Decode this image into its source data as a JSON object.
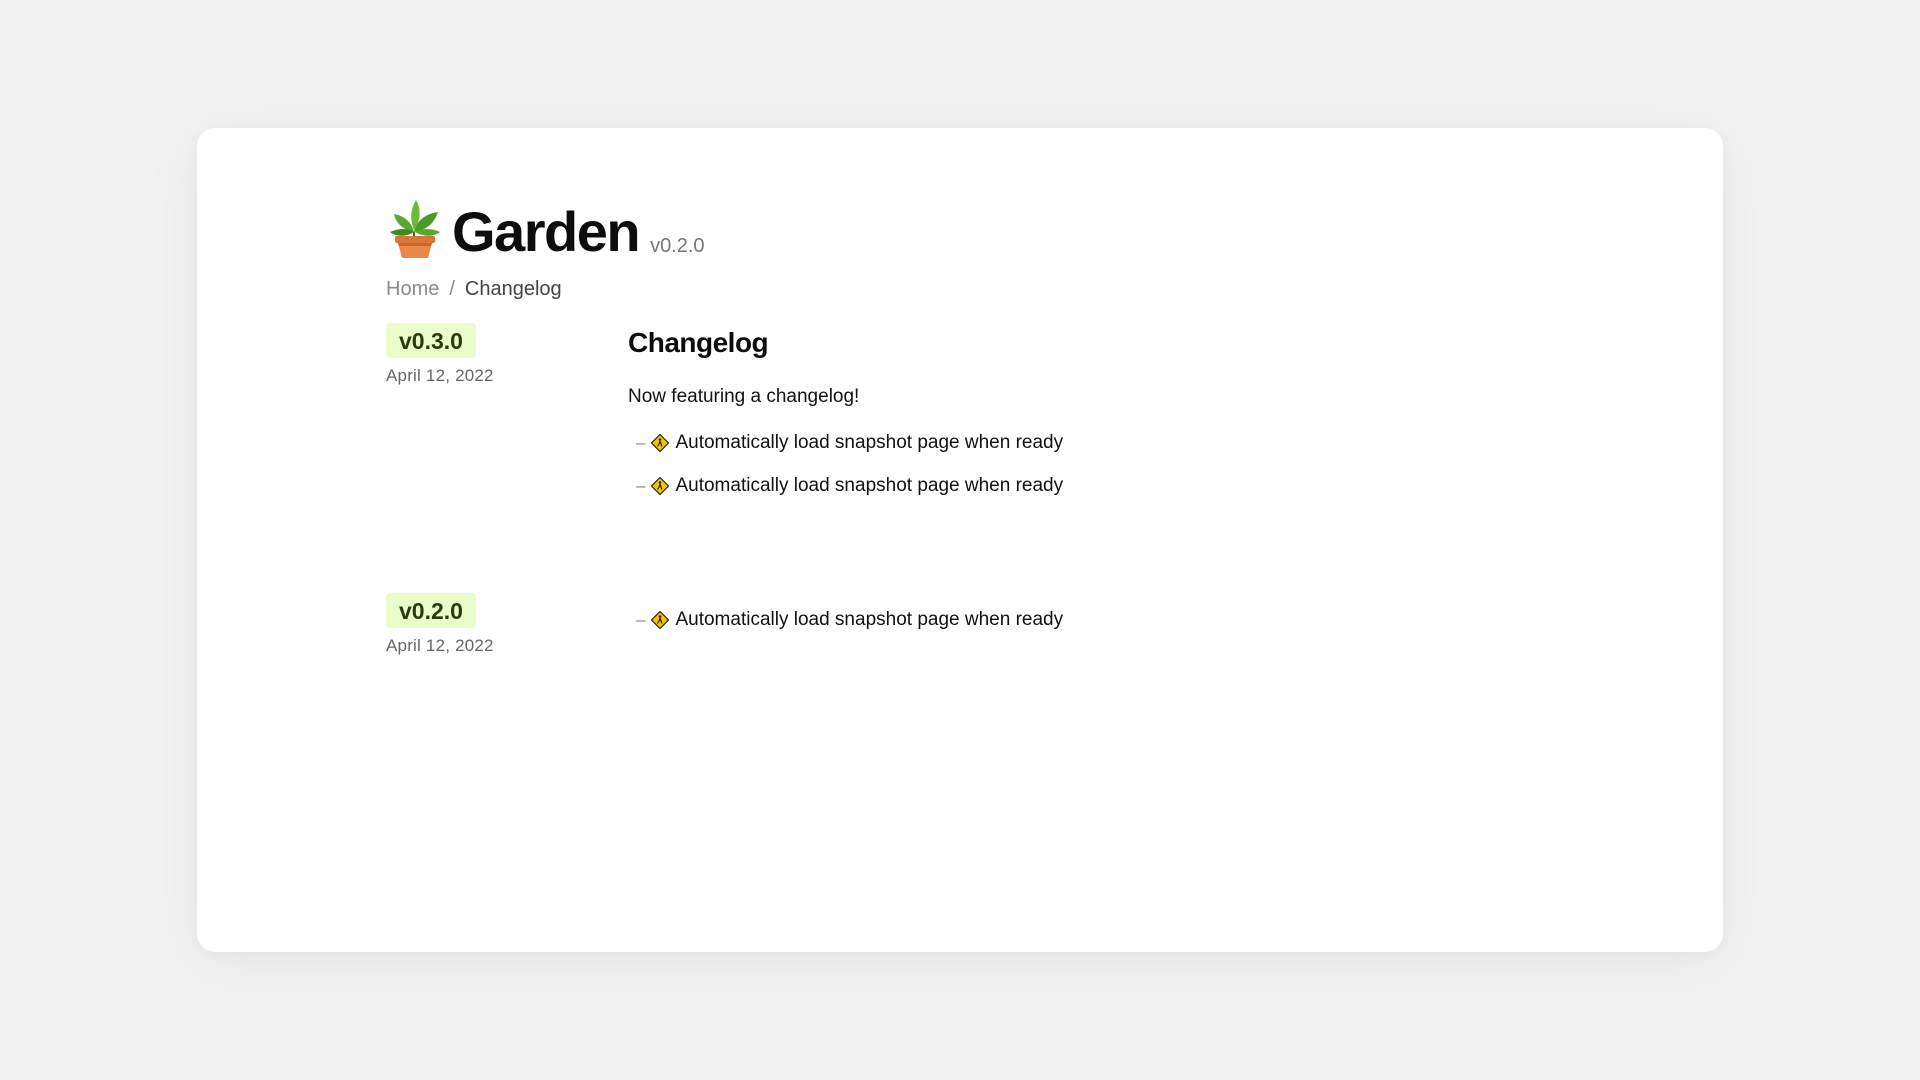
{
  "header": {
    "icon": "potted-plant-icon",
    "title": "Garden",
    "version": "v0.2.0"
  },
  "breadcrumb": {
    "home": "Home",
    "separator": "/",
    "current": "Changelog"
  },
  "releases": [
    {
      "version": "v0.3.0",
      "date": "April 12, 2022",
      "title": "Changelog",
      "description": "Now featuring a changelog!",
      "items": [
        {
          "icon": "construction-sign-icon",
          "text": "Automatically load snapshot page when ready"
        },
        {
          "icon": "construction-sign-icon",
          "text": "Automatically load snapshot page when ready"
        }
      ]
    },
    {
      "version": "v0.2.0",
      "date": "April 12, 2022",
      "items": [
        {
          "icon": "construction-sign-icon",
          "text": "Automatically load snapshot page when ready"
        }
      ]
    }
  ],
  "colors": {
    "background": "#f2f2f2",
    "card": "#ffffff",
    "badge_bg": "#eafcc9",
    "badge_text": "#2a3a12"
  }
}
